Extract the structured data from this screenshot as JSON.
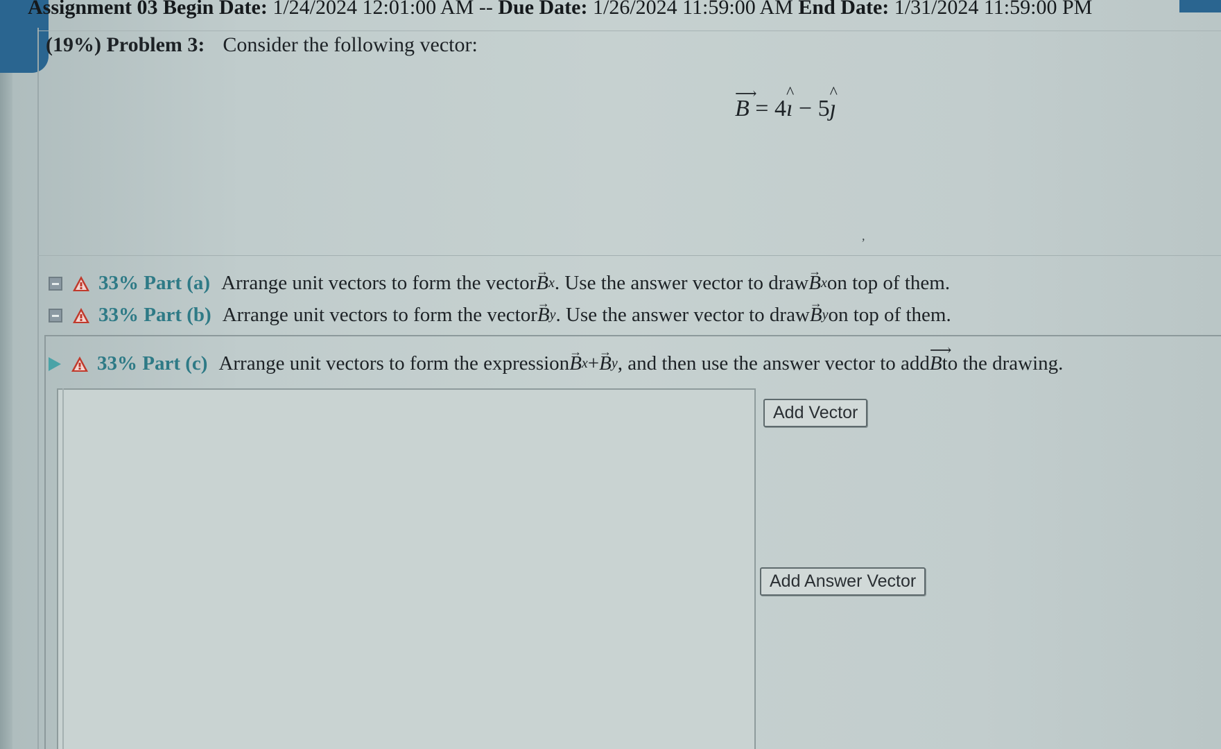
{
  "header": {
    "assignment_prefix": "Assignment 03",
    "begin_label": "Begin Date:",
    "begin_value": "1/24/2024 12:01:00 AM --",
    "due_label": "Due Date:",
    "due_value": "1/26/2024 11:59:00 AM",
    "end_label": "End Date:",
    "end_value": "1/31/2024 11:59:00 PM"
  },
  "problem": {
    "weight": "(19%)",
    "title": "Problem 3:",
    "statement": "Consider the following vector:"
  },
  "equation": {
    "symbol": "B",
    "eq": " = ",
    "coef_i": "4",
    "unit_i": "ı",
    "minus": " − ",
    "coef_j": "5",
    "unit_j": "ȷ"
  },
  "parts": {
    "a": {
      "percent": "33% Part (a)",
      "text_1": "Arrange unit vectors to form the vector ",
      "sym_1": "B",
      "sub_1": "x",
      "text_2": ". Use the answer vector to draw ",
      "sym_2": "B",
      "sub_2": "x",
      "text_3": " on top of them."
    },
    "b": {
      "percent": "33% Part (b)",
      "text_1": "Arrange unit vectors to form the vector ",
      "sym_1": "B",
      "sub_1": "y",
      "text_2": ". Use the answer vector to draw ",
      "sym_2": "B",
      "sub_2": "y",
      "text_3": " on top of them."
    },
    "c": {
      "percent": "33% Part (c)",
      "text_1": "Arrange unit vectors to form the expression ",
      "sym_1": "B",
      "sub_1": "x",
      "plus": " + ",
      "sym_2": "B",
      "sub_2": "y",
      "text_2": ", and then use the answer vector to add ",
      "sym_3": "B",
      "text_3": " to the drawing."
    }
  },
  "buttons": {
    "add_vector": "Add Vector",
    "add_answer_vector": "Add Answer Vector"
  },
  "colors": {
    "part_label": "#2e7a86",
    "warning": "#c0392b",
    "play_arrow": "#4aa3a7"
  },
  "icons": {
    "collapse": "minus-square-icon",
    "warning": "warning-triangle-icon",
    "expand": "play-triangle-icon"
  }
}
